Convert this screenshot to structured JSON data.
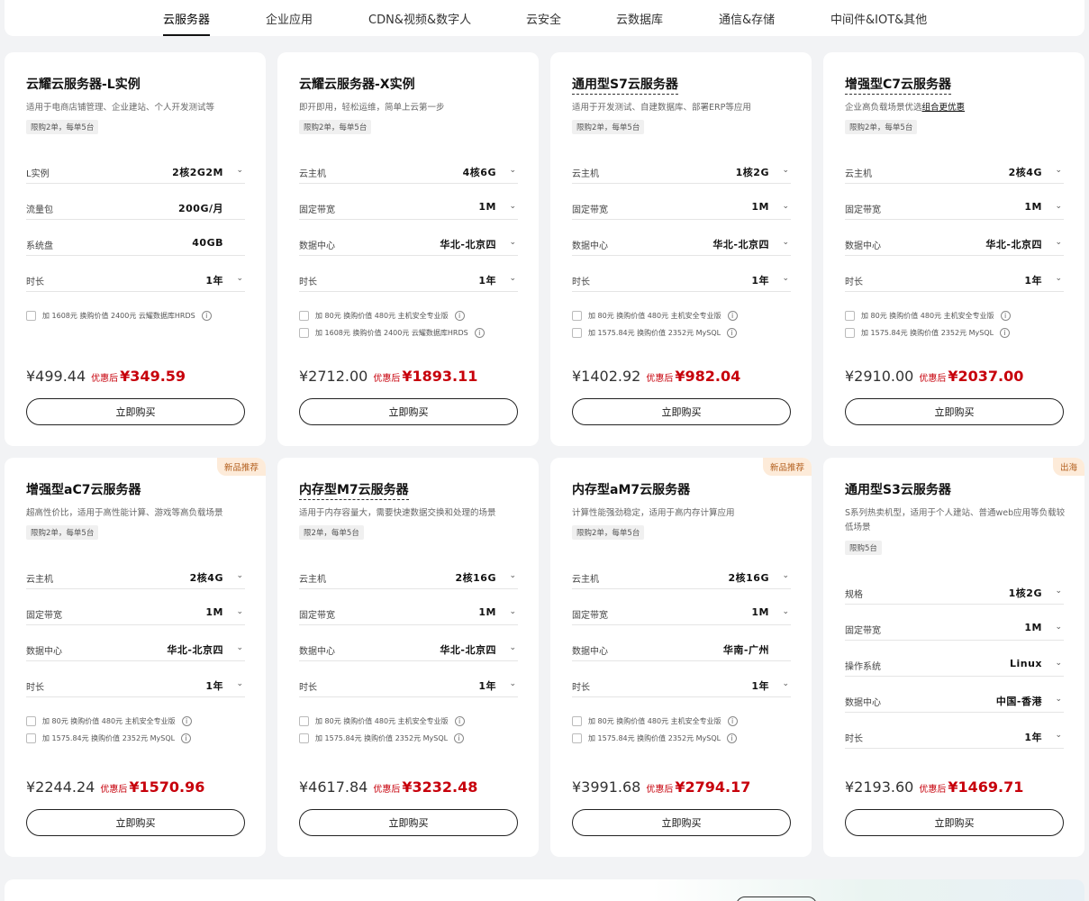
{
  "tabs": [
    "云服务器",
    "企业应用",
    "CDN&视频&数字人",
    "云安全",
    "云数据库",
    "通信&存储",
    "中间件&IOT&其他"
  ],
  "buy_label": "立即购买",
  "after_label": "优惠后",
  "cards": [
    {
      "title": "云耀云服务器-L实例",
      "desc": "适用于电商店铺管理、企业建站、个人开发测试等",
      "limit": "限购2单，每单5台",
      "specs": [
        {
          "label": "L实例",
          "value": "2核2G2M"
        },
        {
          "label": "流量包",
          "value": "200G/月"
        },
        {
          "label": "系统盘",
          "value": "40GB"
        },
        {
          "label": "时长",
          "value": "1年"
        }
      ],
      "addons": [
        "加 1608元 换购价值 2400元 云耀数据库HRDS"
      ],
      "orig": "¥499.44",
      "now": "¥349.59"
    },
    {
      "title": "云耀云服务器-X实例",
      "desc": "即开即用，轻松运维，简单上云第一步",
      "limit": "限购2单，每单5台",
      "specs": [
        {
          "label": "云主机",
          "value": "4核6G"
        },
        {
          "label": "固定带宽",
          "value": "1M"
        },
        {
          "label": "数据中心",
          "value": "华北-北京四"
        },
        {
          "label": "时长",
          "value": "1年"
        }
      ],
      "addons": [
        "加 80元 换购价值 480元 主机安全专业版",
        "加 1608元 换购价值 2400元 云耀数据库HRDS"
      ],
      "orig": "¥2712.00",
      "now": "¥1893.11"
    },
    {
      "title": "通用型S7云服务器",
      "desc": "适用于开发测试、自建数据库、部署ERP等应用",
      "limit": "限购2单，每单5台",
      "specs": [
        {
          "label": "云主机",
          "value": "1核2G"
        },
        {
          "label": "固定带宽",
          "value": "1M"
        },
        {
          "label": "数据中心",
          "value": "华北-北京四"
        },
        {
          "label": "时长",
          "value": "1年"
        }
      ],
      "addons": [
        "加 80元 换购价值 480元 主机安全专业版",
        "加 1575.84元 换购价值 2352元 MySQL"
      ],
      "orig": "¥1402.92",
      "now": "¥982.04"
    },
    {
      "title": "增强型C7云服务器",
      "desc": "企业高负载场景优选",
      "desc_link": "组合更优惠",
      "limit": "限购2单，每单5台",
      "specs": [
        {
          "label": "云主机",
          "value": "2核4G"
        },
        {
          "label": "固定带宽",
          "value": "1M"
        },
        {
          "label": "数据中心",
          "value": "华北-北京四"
        },
        {
          "label": "时长",
          "value": "1年"
        }
      ],
      "addons": [
        "加 80元 换购价值 480元 主机安全专业版",
        "加 1575.84元 换购价值 2352元 MySQL"
      ],
      "orig": "¥2910.00",
      "now": "¥2037.00"
    },
    {
      "badge": "新品推荐",
      "title": "增强型aC7云服务器",
      "desc": "超高性价比，适用于高性能计算、游戏等高负载场景",
      "limit": "限购2单，每单5台",
      "specs": [
        {
          "label": "云主机",
          "value": "2核4G"
        },
        {
          "label": "固定带宽",
          "value": "1M"
        },
        {
          "label": "数据中心",
          "value": "华北-北京四"
        },
        {
          "label": "时长",
          "value": "1年"
        }
      ],
      "addons": [
        "加 80元 换购价值 480元 主机安全专业版",
        "加 1575.84元 换购价值 2352元 MySQL"
      ],
      "orig": "¥2244.24",
      "now": "¥1570.96"
    },
    {
      "title": "内存型M7云服务器",
      "desc": "适用于内存容量大，需要快速数据交换和处理的场景",
      "limit": "限2单，每单5台",
      "specs": [
        {
          "label": "云主机",
          "value": "2核16G"
        },
        {
          "label": "固定带宽",
          "value": "1M"
        },
        {
          "label": "数据中心",
          "value": "华北-北京四"
        },
        {
          "label": "时长",
          "value": "1年"
        }
      ],
      "addons": [
        "加 80元 换购价值 480元 主机安全专业版",
        "加 1575.84元 换购价值 2352元 MySQL"
      ],
      "orig": "¥4617.84",
      "now": "¥3232.48"
    },
    {
      "badge": "新品推荐",
      "title": "内存型aM7云服务器",
      "desc": "计算性能强劲稳定，适用于高内存计算应用",
      "limit": "限购2单，每单5台",
      "specs": [
        {
          "label": "云主机",
          "value": "2核16G"
        },
        {
          "label": "固定带宽",
          "value": "1M"
        },
        {
          "label": "数据中心",
          "value": "华南-广州"
        },
        {
          "label": "时长",
          "value": "1年"
        }
      ],
      "addons": [
        "加 80元 换购价值 480元 主机安全专业版",
        "加 1575.84元 换购价值 2352元 MySQL"
      ],
      "orig": "¥3991.68",
      "now": "¥2794.17"
    },
    {
      "badge": "出海",
      "title": "通用型S3云服务器",
      "desc": "S系列热卖机型，适用于个人建站、普通web应用等负载较低场景",
      "limit": "限购5台",
      "specs": [
        {
          "label": "规格",
          "value": "1核2G"
        },
        {
          "label": "固定带宽",
          "value": "1M"
        },
        {
          "label": "操作系统",
          "value": "Linux"
        },
        {
          "label": "数据中心",
          "value": "中国-香港"
        },
        {
          "label": "时长",
          "value": "1年"
        }
      ],
      "addons": [],
      "orig": "¥2193.60",
      "now": "¥1469.71"
    }
  ]
}
